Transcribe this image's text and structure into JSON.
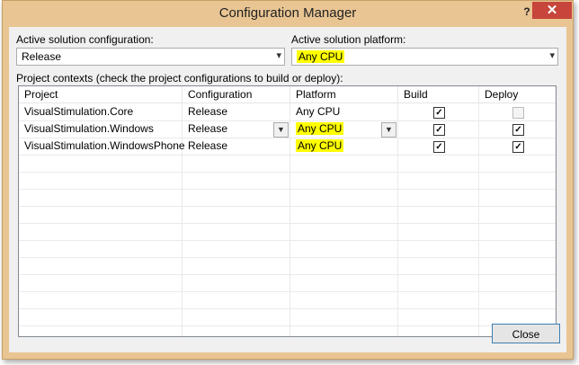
{
  "window": {
    "title": "Configuration Manager",
    "help_label": "?",
    "close_label": "✕"
  },
  "active_config": {
    "label": "Active solution configuration:",
    "value": "Release"
  },
  "active_platform": {
    "label": "Active solution platform:",
    "value": "Any CPU"
  },
  "contexts_label": "Project contexts (check the project configurations to build or deploy):",
  "grid": {
    "columns": [
      "Project",
      "Configuration",
      "Platform",
      "Build",
      "Deploy"
    ],
    "rows": [
      {
        "project": "VisualStimulation.Core",
        "configuration": "Release",
        "platform": "Any CPU",
        "build": true,
        "deploy": false,
        "deploy_enabled": false
      },
      {
        "project": "VisualStimulation.Windows",
        "configuration": "Release",
        "platform": "Any CPU",
        "build": true,
        "deploy": true,
        "deploy_enabled": true
      },
      {
        "project": "VisualStimulation.WindowsPhone",
        "configuration": "Release",
        "platform": "Any CPU",
        "build": true,
        "deploy": true,
        "deploy_enabled": true
      }
    ]
  },
  "close_button": "Close",
  "colors": {
    "frame": "#e9c593",
    "close_red": "#c7453b",
    "highlight": "#ffff00"
  }
}
